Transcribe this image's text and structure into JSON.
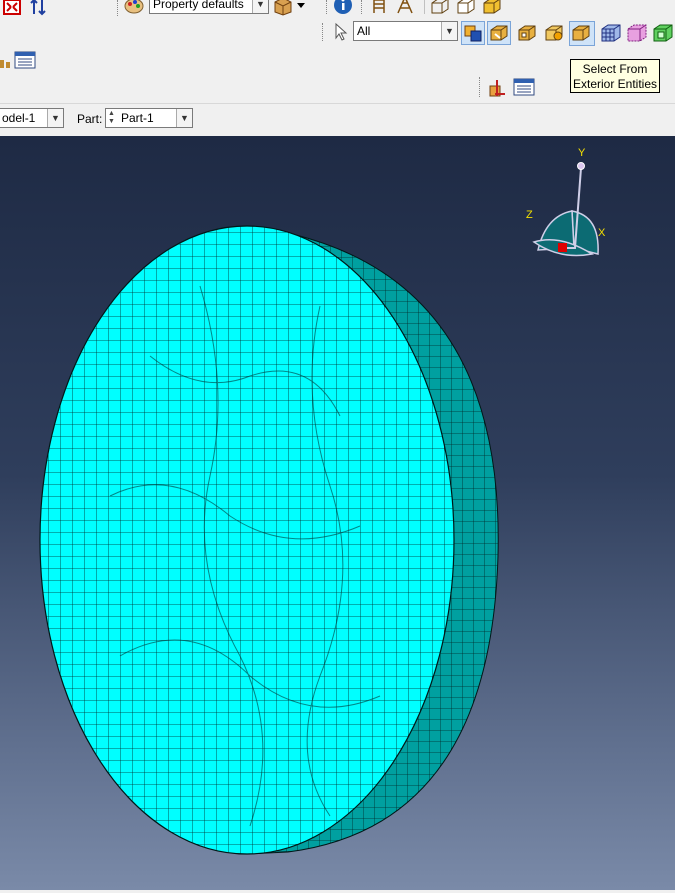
{
  "toolbar": {
    "property_combo": "Property defaults",
    "selection_filter": "All",
    "tooltip_line1": "Select From",
    "tooltip_line2": "Exterior Entities"
  },
  "context_bar": {
    "model_value": "odel-1",
    "part_label": "Part:",
    "part_value": "Part-1"
  },
  "triad": {
    "x_label": "X",
    "y_label": "Y",
    "z_label": "Z"
  },
  "colors": {
    "mesh_face": "#00ffff",
    "mesh_side": "#009a9a",
    "mesh_line": "#002020",
    "viewport_top": "#1e2a44",
    "viewport_bottom": "#7a8aa8"
  }
}
